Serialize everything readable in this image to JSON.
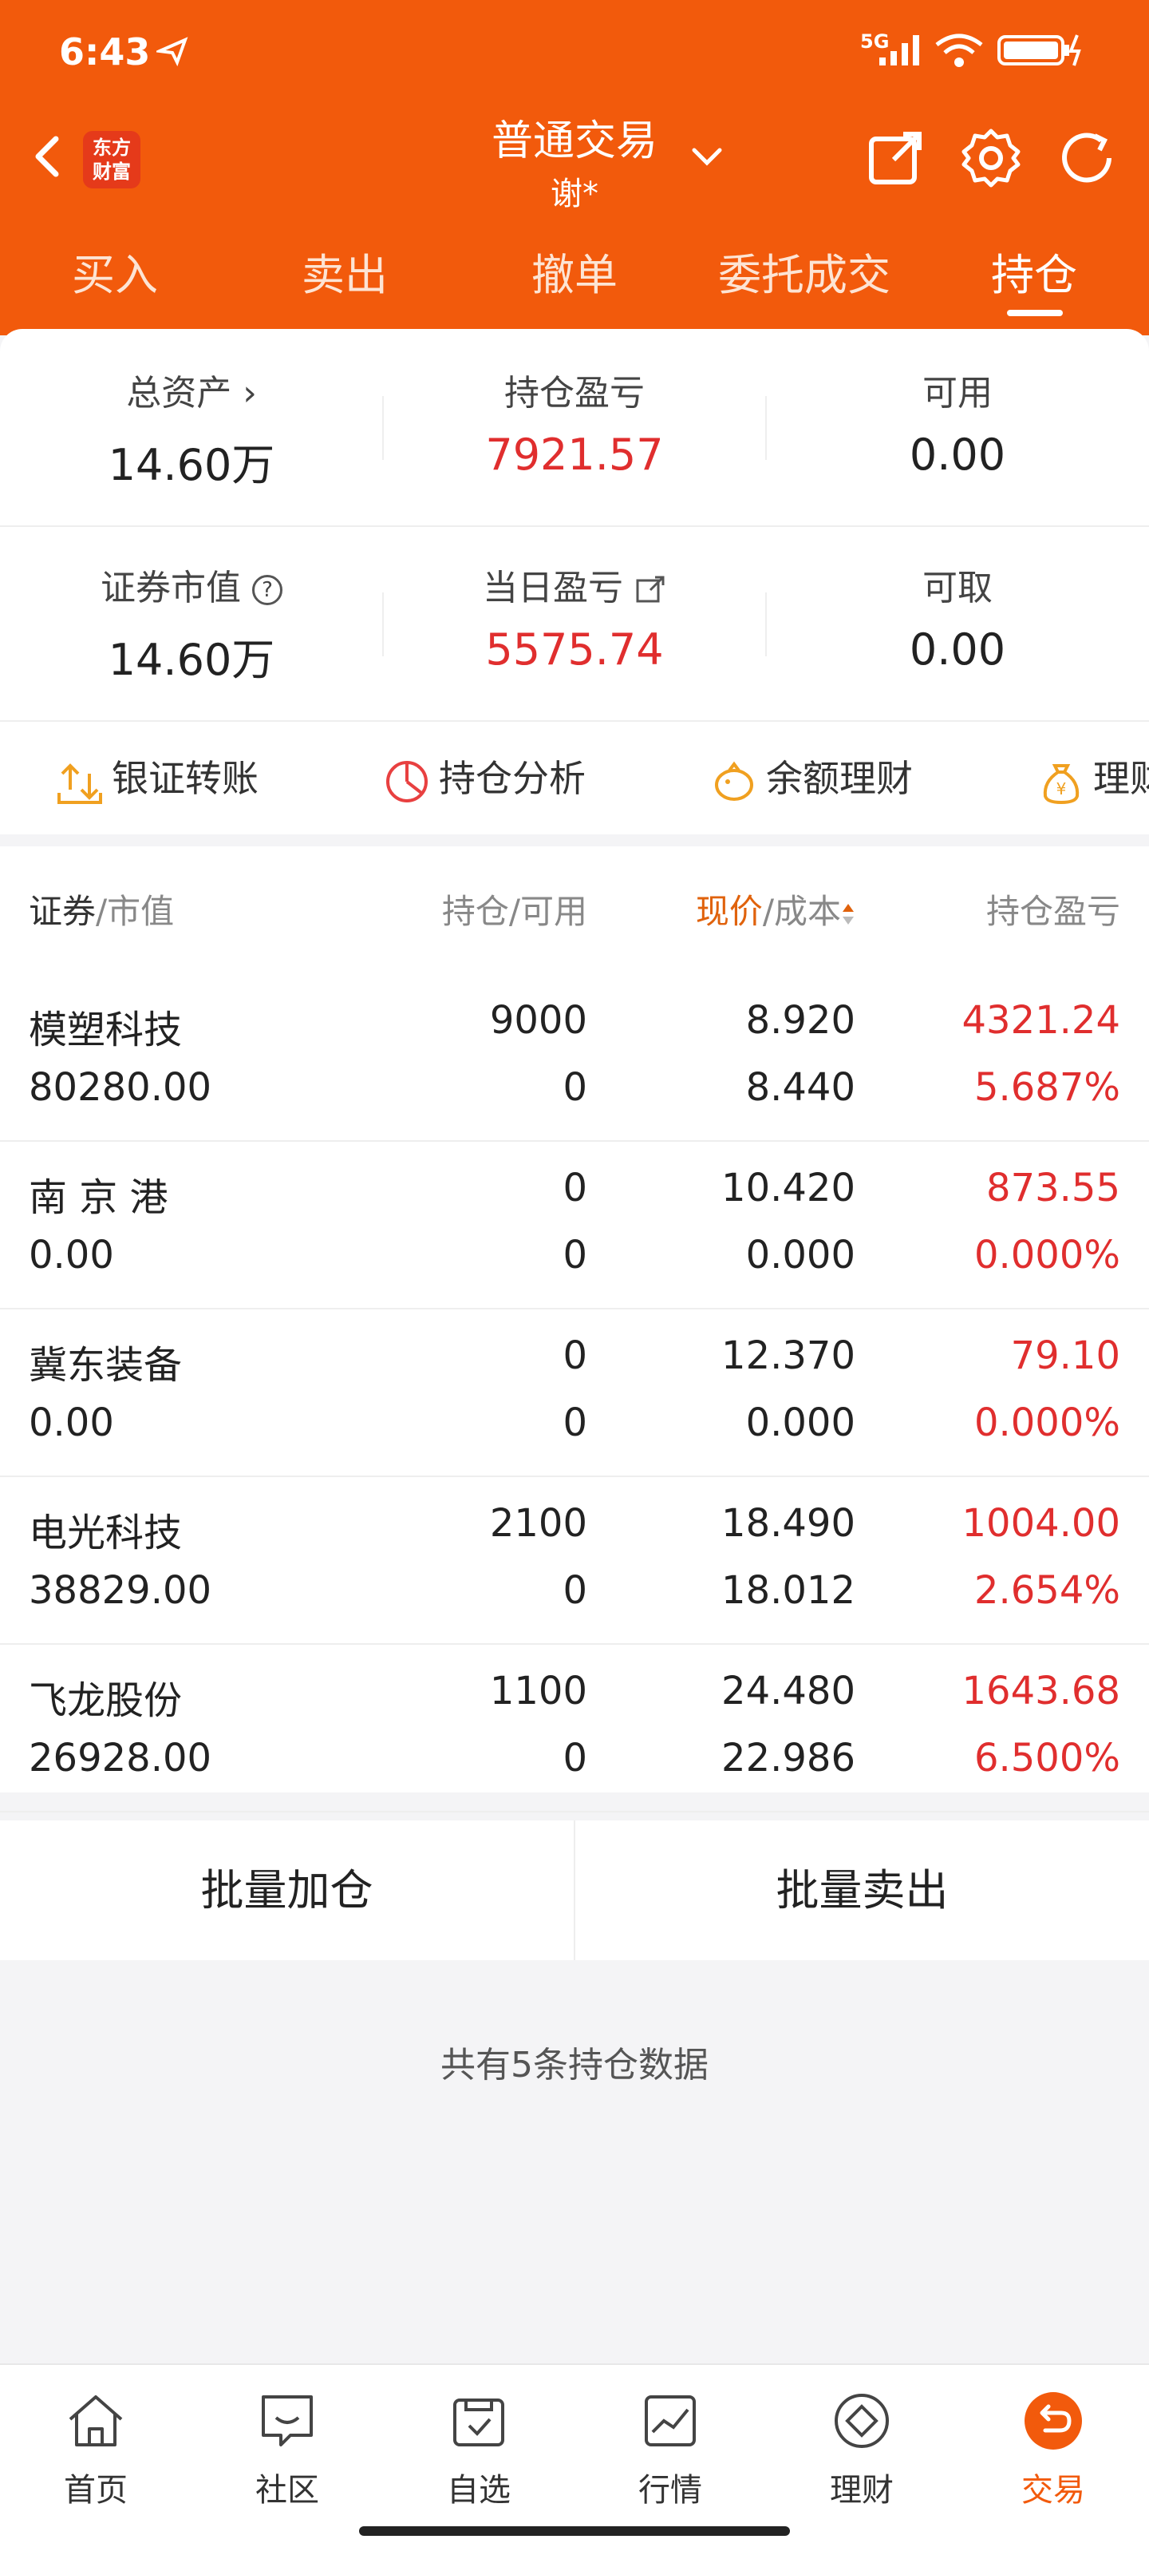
{
  "status_bar": {
    "time": "6:43",
    "network": "5G"
  },
  "nav": {
    "logo_text_line1": "东方",
    "logo_text_line2": "财富",
    "title": "普通交易",
    "subtitle": "谢*"
  },
  "tabs": [
    {
      "label": "买入"
    },
    {
      "label": "卖出"
    },
    {
      "label": "撤单"
    },
    {
      "label": "委托成交"
    },
    {
      "label": "持仓"
    }
  ],
  "summary": {
    "total_assets_label": "总资产 ›",
    "total_assets": "14.60万",
    "position_pl_label": "持仓盈亏",
    "position_pl": "7921.57",
    "available_label": "可用",
    "available": "0.00",
    "market_value_label": "证券市值",
    "market_value": "14.60万",
    "daily_pl_label": "当日盈亏",
    "daily_pl": "5575.74",
    "withdrawable_label": "可取",
    "withdrawable": "0.00"
  },
  "actions": [
    {
      "label": "银证转账"
    },
    {
      "label": "持仓分析"
    },
    {
      "label": "余额理财"
    },
    {
      "label": "理财"
    }
  ],
  "table": {
    "col_security": "证券",
    "col_security_sub": "/市值",
    "col_position": "持仓/可用",
    "col_price": "现价",
    "col_price_sub": "/成本",
    "col_pl": "持仓盈亏",
    "rows": [
      {
        "name": "模塑科技",
        "value": "80280.00",
        "position": "9000",
        "available": "0",
        "price": "8.920",
        "cost": "8.440",
        "pl": "4321.24",
        "pl_pct": "5.687%"
      },
      {
        "name": "南 京 港",
        "value": "0.00",
        "position": "0",
        "available": "0",
        "price": "10.420",
        "cost": "0.000",
        "pl": "873.55",
        "pl_pct": "0.000%"
      },
      {
        "name": "冀东装备",
        "value": "0.00",
        "position": "0",
        "available": "0",
        "price": "12.370",
        "cost": "0.000",
        "pl": "79.10",
        "pl_pct": "0.000%"
      },
      {
        "name": "电光科技",
        "value": "38829.00",
        "position": "2100",
        "available": "0",
        "price": "18.490",
        "cost": "18.012",
        "pl": "1004.00",
        "pl_pct": "2.654%"
      },
      {
        "name": "飞龙股份",
        "value": "26928.00",
        "position": "1100",
        "available": "0",
        "price": "24.480",
        "cost": "22.986",
        "pl": "1643.68",
        "pl_pct": "6.500%"
      }
    ]
  },
  "batch": {
    "add_label": "批量加仓",
    "sell_label": "批量卖出"
  },
  "footer_note": "共有5条持仓数据",
  "bottom_nav": [
    {
      "label": "首页"
    },
    {
      "label": "社区"
    },
    {
      "label": "自选"
    },
    {
      "label": "行情"
    },
    {
      "label": "理财"
    },
    {
      "label": "交易"
    }
  ],
  "colors": {
    "brand": "#f25a0c",
    "loss_gain_red": "#e02e2e"
  }
}
